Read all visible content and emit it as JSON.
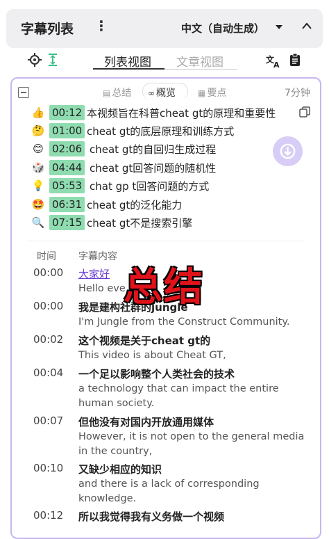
{
  "header": {
    "title": "字幕列表",
    "language": "中文（自动生成）"
  },
  "toolbar": {
    "tab_list": "列表视图",
    "tab_article": "文章视图"
  },
  "summary": {
    "tabs": [
      "总结",
      "概览",
      "要点"
    ],
    "active_tab": "概览",
    "duration": "7分钟",
    "items": [
      {
        "icon": "thumbs-up",
        "emoji": "👍",
        "time": "00:12",
        "text": "本视频旨在科普cheat gt的原理和重要性"
      },
      {
        "icon": "thinking-face",
        "emoji": "🤔",
        "time": "01:00",
        "text": "cheat gt的底层原理和训练方式"
      },
      {
        "icon": "smile-face",
        "emoji": "😊",
        "time": "02:06",
        "text": "cheat gt的自回归生成过程"
      },
      {
        "icon": "dice",
        "emoji": "🎲",
        "time": "04:44",
        "text": "cheat gt回答问题的随机性"
      },
      {
        "icon": "light-bulb",
        "emoji": "💡",
        "time": "05:53",
        "text": "chat gp t回答问题的方式"
      },
      {
        "icon": "star-struck-face",
        "emoji": "🤩",
        "time": "06:31",
        "text": "cheat gt的泛化能力"
      },
      {
        "icon": "magnifier",
        "emoji": "🔍",
        "time": "07:15",
        "text": "cheat gt不是搜索引擎"
      }
    ]
  },
  "subtitles": {
    "col_time": "时间",
    "col_content": "字幕内容",
    "rows": [
      {
        "time": "00:00",
        "zh": "大家好",
        "en": "Hello eve"
      },
      {
        "time": "00:00",
        "zh": "我是建构社群的jungle",
        "en": "I'm Jungle from the Construct Community."
      },
      {
        "time": "00:02",
        "zh": "这个视频是关于cheat gt的",
        "en": "This video is about Cheat GT,"
      },
      {
        "time": "00:04",
        "zh": "一个足以影响整个人类社会的技术",
        "en": "a technology that can impact the entire human society."
      },
      {
        "time": "00:07",
        "zh": "但他没有对国内开放通用媒体",
        "en": "However, it is not open to the general media in the country,"
      },
      {
        "time": "00:10",
        "zh": "又缺少相应的知识",
        "en": "and there is a lack of corresponding knowledge."
      },
      {
        "time": "00:12",
        "zh": "所以我觉得我有义务做一个视频",
        "en": ""
      }
    ]
  },
  "overlay_text": "总结",
  "colors": {
    "accent_purple": "#c8b6ef",
    "timestamp_green": "#8fdcb0",
    "link_purple": "#6a3fd6",
    "overlay_red": "#e0131a"
  }
}
